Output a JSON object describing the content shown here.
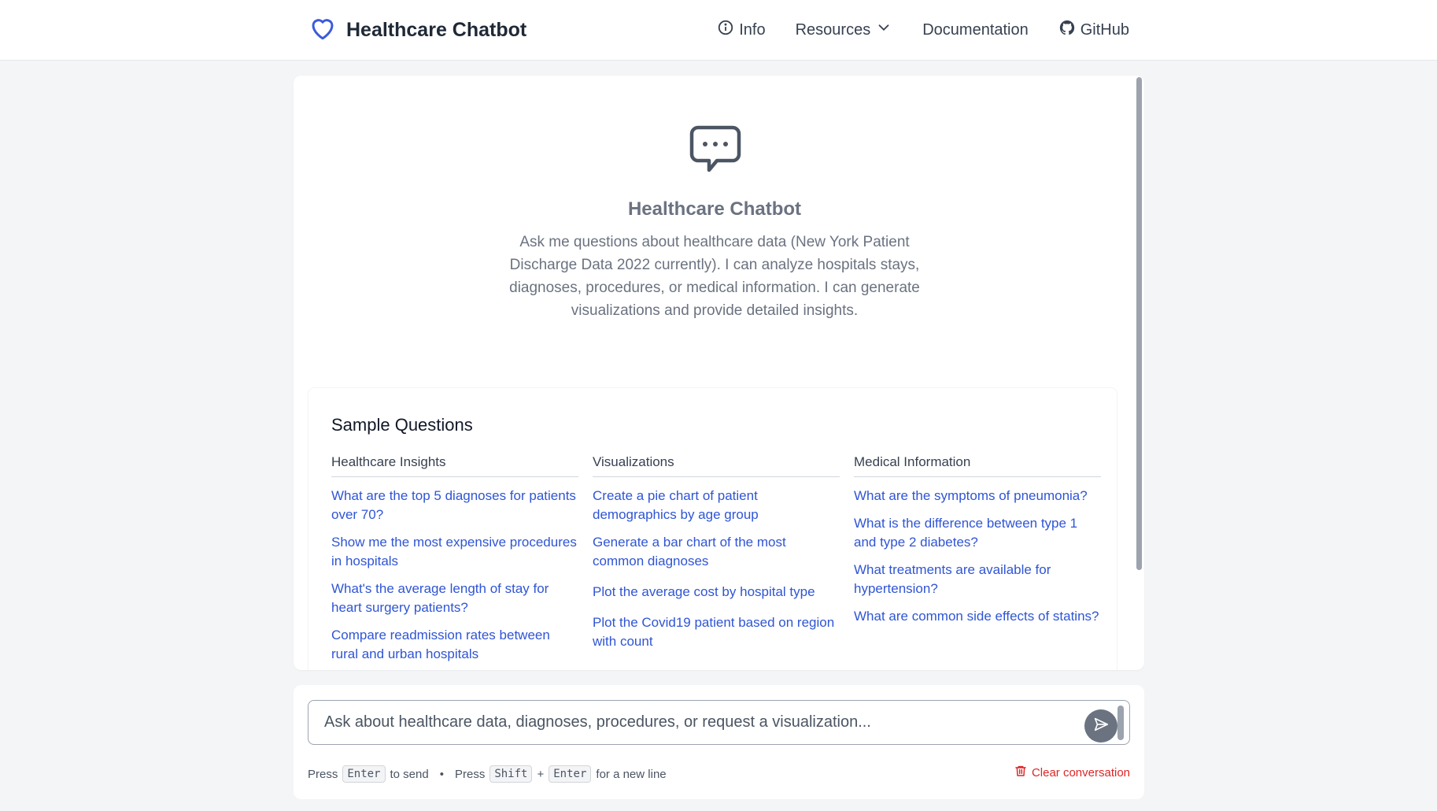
{
  "header": {
    "title": "Healthcare Chatbot",
    "nav": {
      "info": "Info",
      "resources": "Resources",
      "documentation": "Documentation",
      "github": "GitHub"
    }
  },
  "hero": {
    "title": "Healthcare Chatbot",
    "description": "Ask me questions about healthcare data (New York Patient Discharge Data 2022 currently). I can analyze hospitals stays, diagnoses, procedures, or medical information. I can generate visualizations and provide detailed insights."
  },
  "samples": {
    "heading": "Sample Questions",
    "columns": [
      {
        "title": "Healthcare Insights",
        "questions": [
          "What are the top 5 diagnoses for patients over 70?",
          "Show me the most expensive procedures in hospitals",
          "What's the average length of stay for heart surgery patients?",
          "Compare readmission rates between rural and urban hospitals"
        ]
      },
      {
        "title": "Visualizations",
        "questions": [
          "Create a pie chart of patient demographics by age group",
          "Generate a bar chart of the most common diagnoses",
          "Plot the average cost by hospital type",
          "Plot the Covid19 patient based on region with count"
        ]
      },
      {
        "title": "Medical Information",
        "questions": [
          "What are the symptoms of pneumonia?",
          "What is the difference between type 1 and type 2 diabetes?",
          "What treatments are available for hypertension?",
          "What are common side effects of statins?"
        ]
      }
    ]
  },
  "input": {
    "placeholder": "Ask about healthcare data, diagnoses, procedures, or request a visualization...",
    "value": ""
  },
  "hints": {
    "press1": "Press",
    "enter": "Enter",
    "to_send": "to send",
    "separator": "•",
    "press2": "Press",
    "shift": "Shift",
    "plus": "+",
    "enter2": "Enter",
    "new_line": "for a new line"
  },
  "clear_label": "Clear conversation",
  "colors": {
    "accent": "#2f55d4",
    "brand_heart": "#3b5bdb",
    "danger": "#dc2626"
  },
  "icons": {
    "brand": "heart-icon",
    "info": "info-icon",
    "resources": "chevron-down-icon",
    "github": "github-icon",
    "hero": "chat-bubble-icon",
    "send": "send-icon",
    "clear": "trash-icon"
  }
}
